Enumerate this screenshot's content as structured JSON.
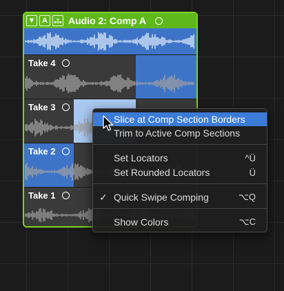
{
  "track": {
    "title": "Audio 2: Comp A",
    "header_buttons": [
      "▼",
      "A"
    ]
  },
  "takes": [
    {
      "label": "Take 4"
    },
    {
      "label": "Take 3"
    },
    {
      "label": "Take 2"
    },
    {
      "label": "Take 1"
    }
  ],
  "menu": {
    "items": [
      {
        "label": "Slice at Comp Section Borders",
        "shortcut": ""
      },
      {
        "label": "Trim to Active Comp Sections",
        "shortcut": ""
      },
      {
        "label": "Set Locators",
        "shortcut": "^Ü"
      },
      {
        "label": "Set Rounded Locators",
        "shortcut": "Ü"
      },
      {
        "label": "Quick Swipe Comping",
        "shortcut": "⌥Q",
        "check": "✓"
      },
      {
        "label": "Show Colors",
        "shortcut": "⌥C"
      }
    ]
  },
  "colors": {
    "folder_green": "#7ed321",
    "header_green": "#5fb81a",
    "comp_blue": "#3e74c8",
    "highlight_blue": "#3c7bd7",
    "selection_light": "#a9c8f0"
  }
}
